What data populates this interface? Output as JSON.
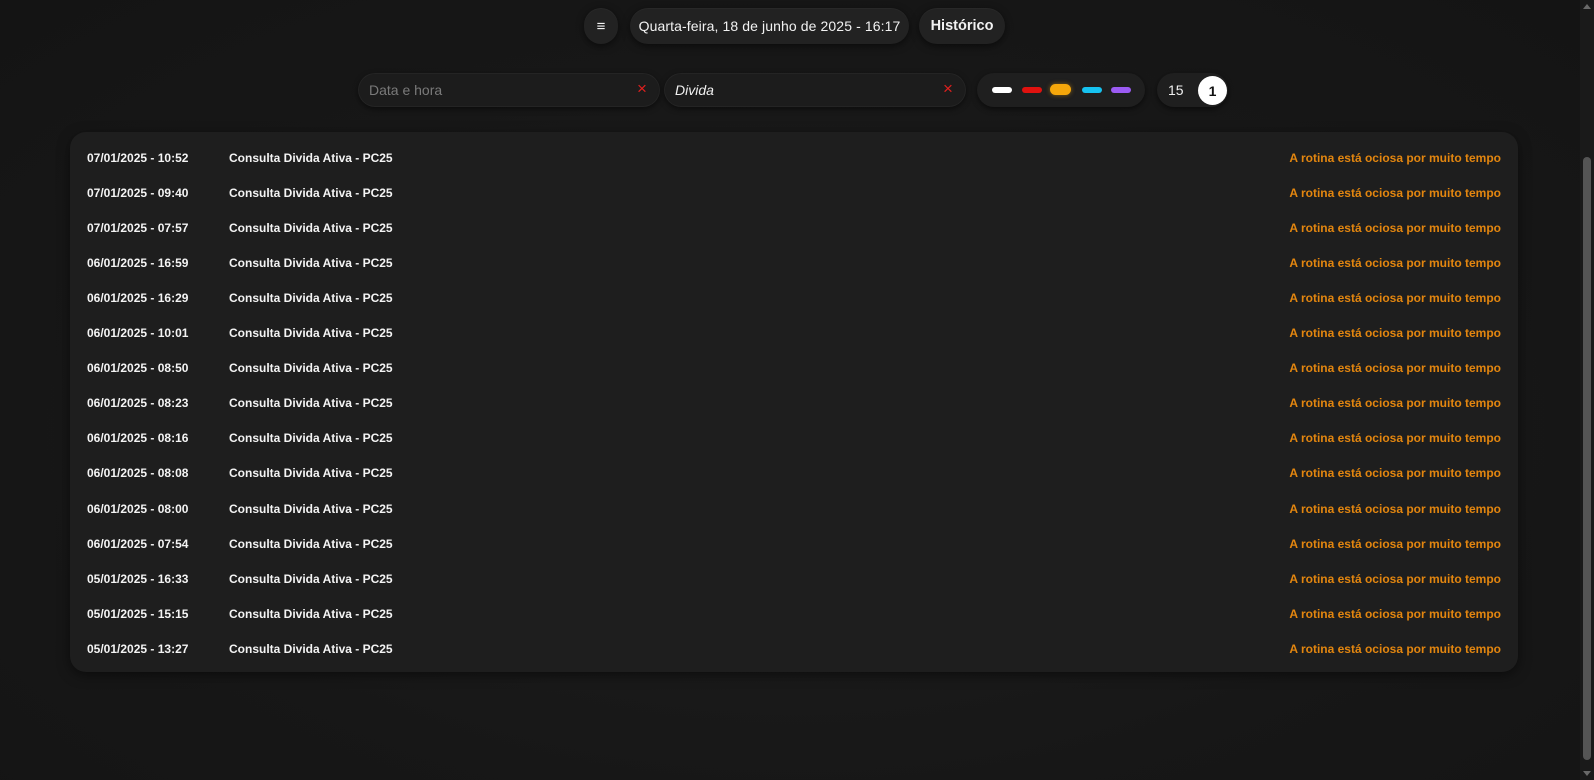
{
  "header": {
    "menu_icon": "≡",
    "datetime": "Quarta-feira, 18 de junho de 2025 - 16:17",
    "history_label": "Histórico"
  },
  "filters": {
    "date": {
      "value": "",
      "placeholder": "Data e hora",
      "clear_icon": "×"
    },
    "name": {
      "value": "Divida",
      "placeholder": "",
      "clear_icon": "×"
    }
  },
  "color_filters": [
    {
      "name": "white",
      "color": "#ffffff",
      "selected": false
    },
    {
      "name": "red",
      "color": "#e0120f",
      "selected": false
    },
    {
      "name": "amber",
      "color": "#f5a70b",
      "selected": true
    },
    {
      "name": "cyan",
      "color": "#16c2f0",
      "selected": false
    },
    {
      "name": "purple",
      "color": "#9b5bf3",
      "selected": false
    }
  ],
  "pagination": {
    "page_size": "15",
    "current_page": "1"
  },
  "colors": {
    "status": "#e3860f",
    "clear": "#e0201e"
  },
  "rows": [
    {
      "datetime": "07/01/2025 - 10:52",
      "name": "Consulta Divida Ativa - PC25",
      "status": "A rotina está ociosa por muito tempo"
    },
    {
      "datetime": "07/01/2025 - 09:40",
      "name": "Consulta Divida Ativa - PC25",
      "status": "A rotina está ociosa por muito tempo"
    },
    {
      "datetime": "07/01/2025 - 07:57",
      "name": "Consulta Divida Ativa - PC25",
      "status": "A rotina está ociosa por muito tempo"
    },
    {
      "datetime": "06/01/2025 - 16:59",
      "name": "Consulta Divida Ativa - PC25",
      "status": "A rotina está ociosa por muito tempo"
    },
    {
      "datetime": "06/01/2025 - 16:29",
      "name": "Consulta Divida Ativa - PC25",
      "status": "A rotina está ociosa por muito tempo"
    },
    {
      "datetime": "06/01/2025 - 10:01",
      "name": "Consulta Divida Ativa - PC25",
      "status": "A rotina está ociosa por muito tempo"
    },
    {
      "datetime": "06/01/2025 - 08:50",
      "name": "Consulta Divida Ativa - PC25",
      "status": "A rotina está ociosa por muito tempo"
    },
    {
      "datetime": "06/01/2025 - 08:23",
      "name": "Consulta Divida Ativa - PC25",
      "status": "A rotina está ociosa por muito tempo"
    },
    {
      "datetime": "06/01/2025 - 08:16",
      "name": "Consulta Divida Ativa - PC25",
      "status": "A rotina está ociosa por muito tempo"
    },
    {
      "datetime": "06/01/2025 - 08:08",
      "name": "Consulta Divida Ativa - PC25",
      "status": "A rotina está ociosa por muito tempo"
    },
    {
      "datetime": "06/01/2025 - 08:00",
      "name": "Consulta Divida Ativa - PC25",
      "status": "A rotina está ociosa por muito tempo"
    },
    {
      "datetime": "06/01/2025 - 07:54",
      "name": "Consulta Divida Ativa - PC25",
      "status": "A rotina está ociosa por muito tempo"
    },
    {
      "datetime": "05/01/2025 - 16:33",
      "name": "Consulta Divida Ativa - PC25",
      "status": "A rotina está ociosa por muito tempo"
    },
    {
      "datetime": "05/01/2025 - 15:15",
      "name": "Consulta Divida Ativa - PC25",
      "status": "A rotina está ociosa por muito tempo"
    },
    {
      "datetime": "05/01/2025 - 13:27",
      "name": "Consulta Divida Ativa - PC25",
      "status": "A rotina está ociosa por muito tempo"
    }
  ]
}
